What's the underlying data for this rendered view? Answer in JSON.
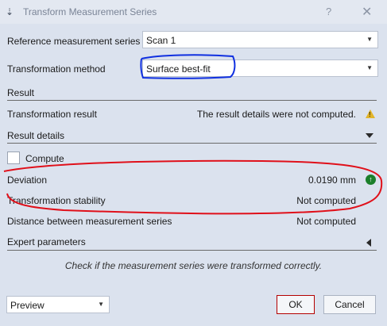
{
  "window": {
    "title": "Transform Measurement Series",
    "help_glyph": "?",
    "close_glyph": "✕",
    "app_icon_glyph": "⇣"
  },
  "fields": {
    "reference_label": "Reference measurement series",
    "reference_value": "Scan 1",
    "method_label": "Transformation method",
    "method_value": "Surface best-fit"
  },
  "result_section": {
    "title": "Result",
    "transformation_result_label": "Transformation result",
    "transformation_result_value": "The result details were not computed."
  },
  "details_section": {
    "title": "Result details",
    "compute_label": "Compute",
    "rows": [
      {
        "label": "Deviation",
        "value": "0.0190 mm"
      },
      {
        "label": "Transformation stability",
        "value": "Not computed"
      },
      {
        "label": "Distance between measurement series",
        "value": "Not computed"
      }
    ]
  },
  "expert_section": {
    "title": "Expert parameters"
  },
  "hint": "Check if the measurement series were transformed correctly.",
  "footer": {
    "preview_value": "Preview",
    "ok_label": "OK",
    "cancel_label": "Cancel"
  },
  "colors": {
    "annotation_red": "#e0101a",
    "annotation_blue": "#1030e0",
    "status_ok": "#1b7f2a",
    "warning": "#e2b42a"
  },
  "icons": {
    "warning": "warning-icon",
    "status_ok": "check-circle-icon",
    "dropdown": "chevron-down-icon",
    "collapse": "triangle-down-icon",
    "expand": "triangle-left-icon"
  }
}
